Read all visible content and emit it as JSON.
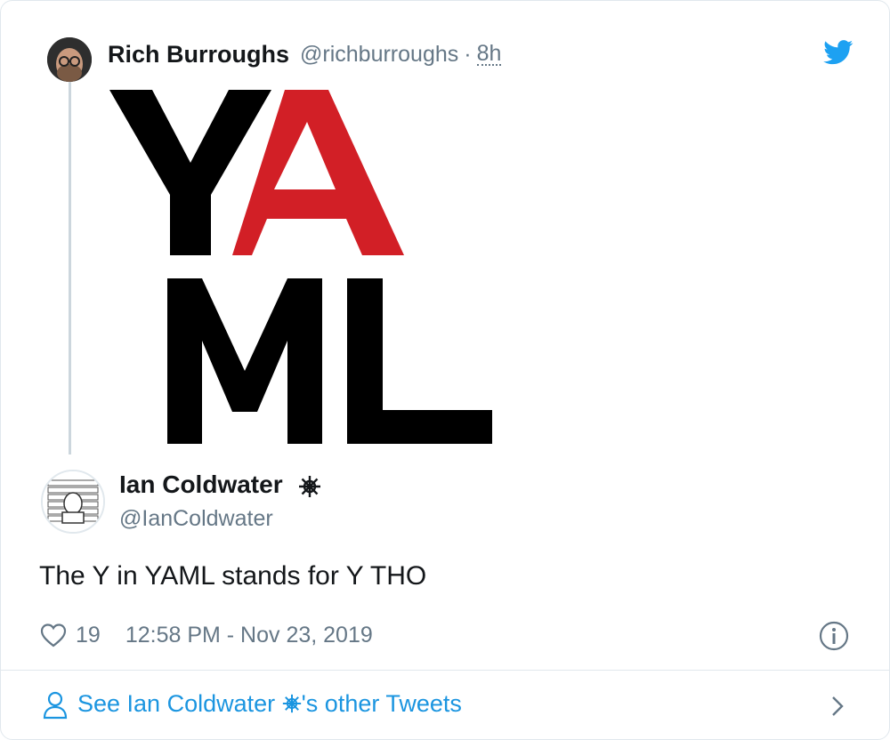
{
  "quoted_tweet": {
    "author_name": "Rich Burroughs",
    "handle": "@richburroughs",
    "separator": "·",
    "time": "8h",
    "image_text": {
      "line1_black": "Y",
      "line1_red": "A",
      "line2": "ML"
    }
  },
  "tweet": {
    "author_name": "Ian Coldwater",
    "handle": "@IanColdwater",
    "text": "The Y in YAML stands for Y THO",
    "likes": "19",
    "timestamp": "12:58 PM - Nov 23, 2019"
  },
  "footer": {
    "link_prefix": "See Ian Coldwater ",
    "link_suffix": "'s other Tweets"
  },
  "colors": {
    "brand": "#1da1f2",
    "link": "#1b95e0",
    "muted": "#657786",
    "yaml_red": "#d21f26"
  },
  "icons": [
    "twitter-bird-icon",
    "helm-wheel-icon",
    "heart-icon",
    "info-icon",
    "person-icon",
    "chevron-right-icon"
  ]
}
